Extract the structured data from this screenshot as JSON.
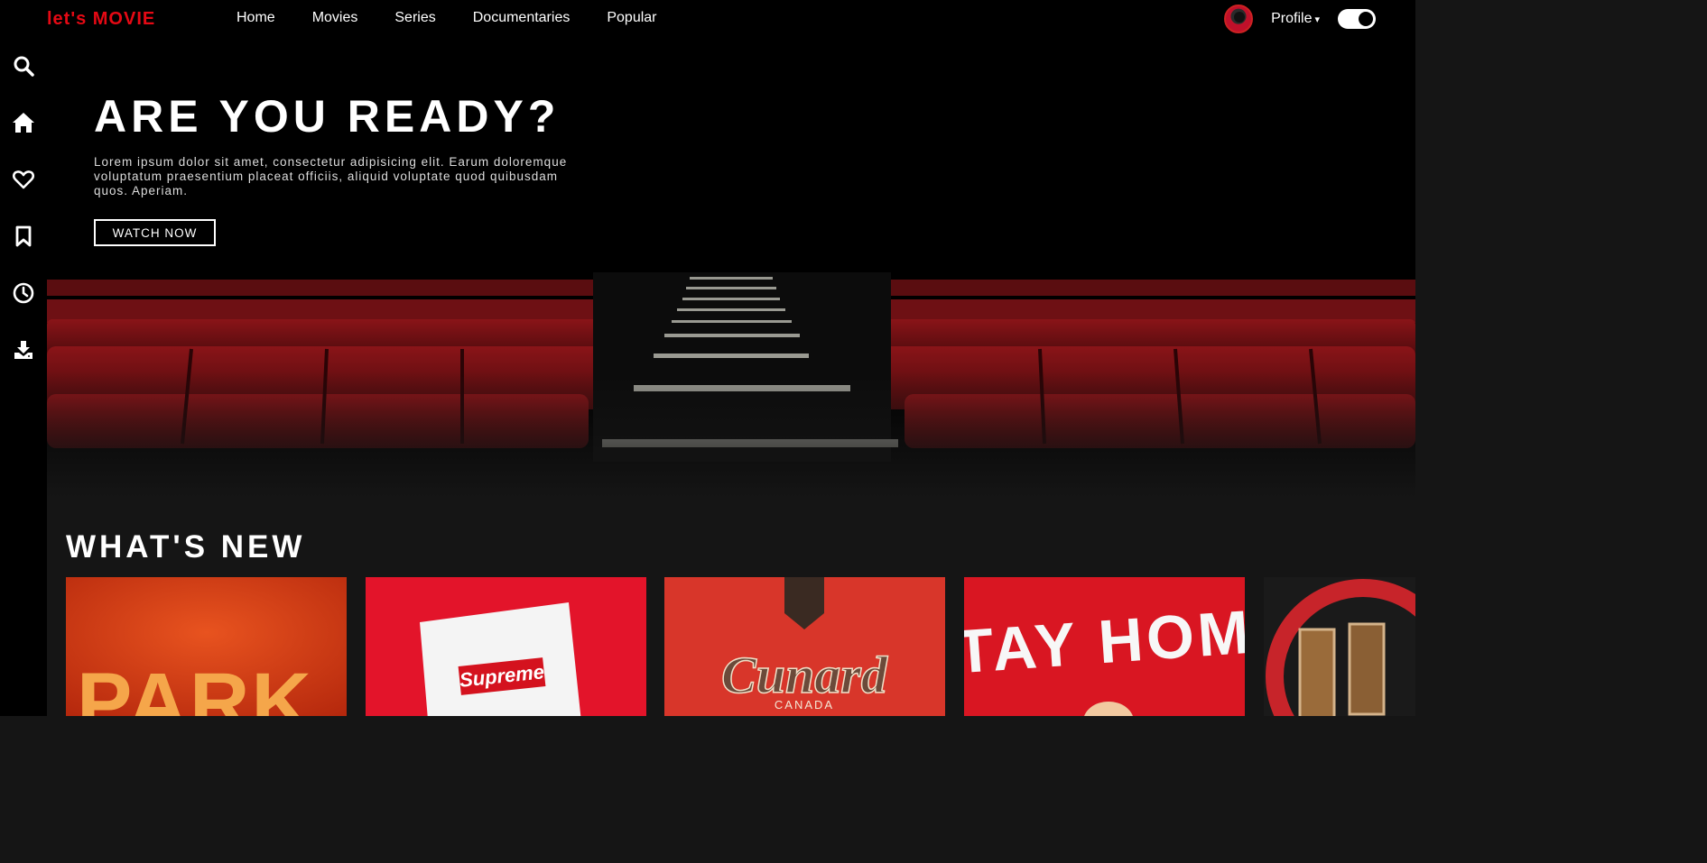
{
  "navbar": {
    "logo": "let's MOVIE",
    "menu": [
      "Home",
      "Movies",
      "Series",
      "Documentaries",
      "Popular"
    ],
    "profile_label": "Profile",
    "caret": "▾"
  },
  "sidebar": {
    "icons": [
      "search-icon",
      "home-icon",
      "heart-icon",
      "bookmark-icon",
      "clock-icon",
      "download-icon"
    ]
  },
  "hero": {
    "title": "ARE YOU READY?",
    "description": "Lorem ipsum dolor sit amet, consectetur adipisicing elit. Earum doloremque voluptatum praesentium placeat officiis, aliquid voluptate quod quibusdam quos. Aperiam.",
    "button": "WATCH NOW"
  },
  "section": {
    "title": "WHAT'S NEW"
  },
  "cards": [
    {
      "text": "PARK"
    },
    {
      "text": "Supreme"
    },
    {
      "text": "Cunard",
      "subtext": "CANADA"
    },
    {
      "text": "STAY HOME"
    },
    {
      "text": ""
    }
  ],
  "colors": {
    "accent": "#e50914",
    "background": "#151515",
    "bar": "#000000"
  }
}
